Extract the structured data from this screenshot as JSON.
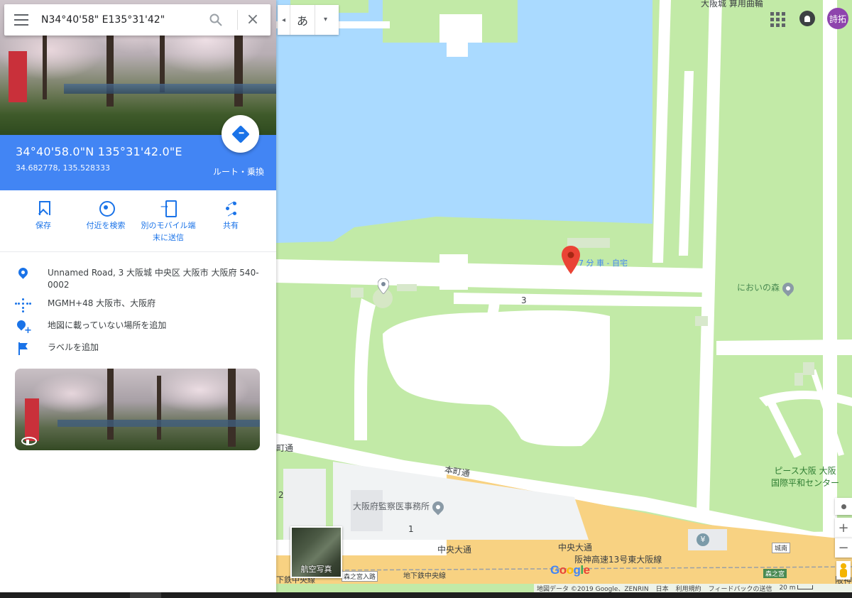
{
  "search": {
    "value": "N34°40'58\" E135°31'42\""
  },
  "place": {
    "coord_dms": "34°40'58.0\"N 135°31'42.0\"E",
    "coord_decimal": "34.682778, 135.528333",
    "directions_label": "ルート・乗換"
  },
  "actions": [
    {
      "label": "保存",
      "icon": "bookmark-icon"
    },
    {
      "label": "付近を検索",
      "icon": "nearby-icon"
    },
    {
      "label": "別のモバイル端末に送信",
      "icon": "send-to-phone-icon"
    },
    {
      "label": "共有",
      "icon": "share-icon"
    }
  ],
  "details": {
    "address": "Unnamed Road, 3 大阪城 中央区 大阪市 大阪府 540-0002",
    "plus_code": "MGMH+48 大阪市、大阪府",
    "add_missing_place": "地図に載っていない場所を追加",
    "add_label": "ラベルを追加"
  },
  "map": {
    "language_button": "あ",
    "avatar_text": "詩拓",
    "route_hint": "7 分 車 - 自宅",
    "road_number_3": "3",
    "road_number_1": "1",
    "road_number_2": "2",
    "labels": {
      "nioi_no_mori": "においの森",
      "peace_osaka": "ピース大阪 大阪",
      "peace_center": "国際平和センター",
      "medical_examiner": "大阪府監察医事務所",
      "honmachi_dori": "本町通",
      "honmachi_dori_left": "町通",
      "chuo_odori_1": "中央大通",
      "chuo_odori_2": "中央大通",
      "hanshin_expressway": "阪神高速13号東大阪線",
      "hanshin_right": "阪神高",
      "subway_chuo": "地下鉄中央線",
      "subway_left": "下鉄中央線",
      "morinomiya_iriguchi": "森之宮入路",
      "morinomiya": "森之宮",
      "shironan": "城南",
      "top_label": "大阪城 算用曲輪"
    },
    "satellite_label": "航空写真",
    "google_logo": "Google",
    "footer": {
      "map_data": "地図データ ©2019 Google、ZENRIN",
      "country": "日本",
      "terms": "利用規約",
      "feedback": "フィードバックの送信",
      "scale": "20 m"
    },
    "colors": {
      "park": "#c2eaa7",
      "water": "#aadaff",
      "road": "#ffffff",
      "highway": "#f8d282",
      "marker": "#ea4335",
      "accent": "#4285f4"
    }
  }
}
